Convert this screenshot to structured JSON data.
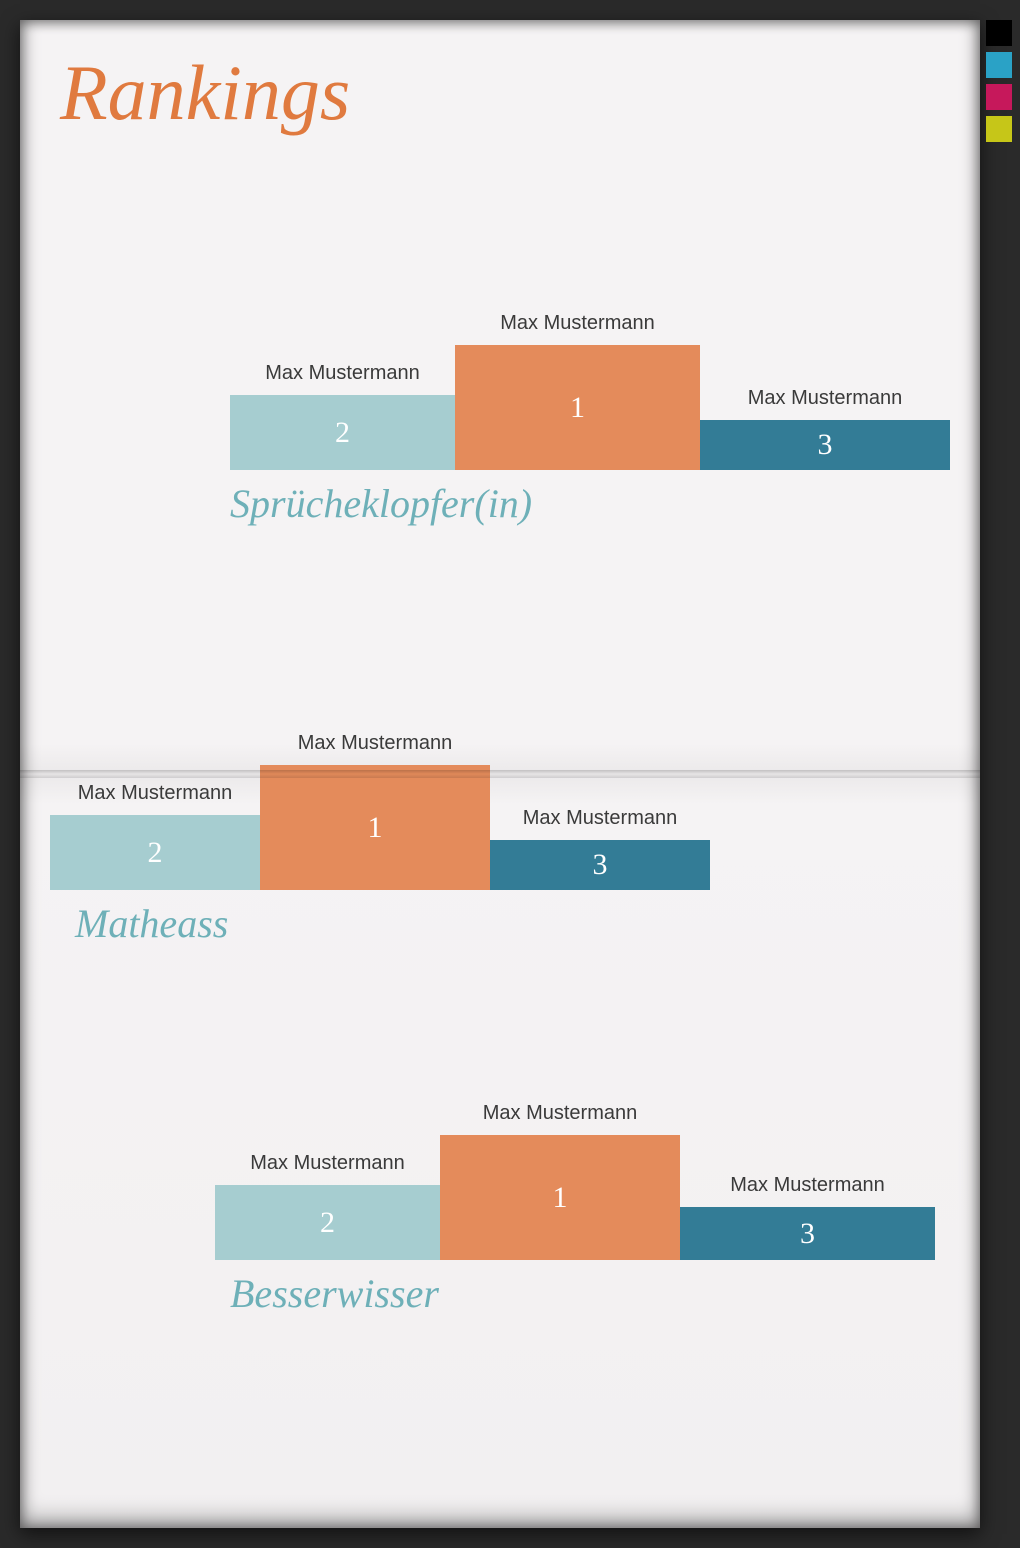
{
  "title": "Rankings",
  "print_bars": [
    "#000000",
    "#2aa2c6",
    "#c6185b",
    "#c6c618"
  ],
  "charts": [
    {
      "subtitle": "Sprücheklopfer(in)",
      "second": {
        "name": "Max Mustermann",
        "rank": "2"
      },
      "first": {
        "name": "Max Mustermann",
        "rank": "1"
      },
      "third": {
        "name": "Max Mustermann",
        "rank": "3"
      }
    },
    {
      "subtitle": "Matheass",
      "second": {
        "name": "Max Mustermann",
        "rank": "2"
      },
      "first": {
        "name": "Max Mustermann",
        "rank": "1"
      },
      "third": {
        "name": "Max Mustermann",
        "rank": "3"
      }
    },
    {
      "subtitle": "Besserwisser",
      "second": {
        "name": "Max Mustermann",
        "rank": "2"
      },
      "first": {
        "name": "Max Mustermann",
        "rank": "1"
      },
      "third": {
        "name": "Max Mustermann",
        "rank": "3"
      }
    }
  ],
  "chart_data": [
    {
      "type": "bar",
      "title": "Sprücheklopfer(in)",
      "categories": [
        "2nd — Max Mustermann",
        "1st — Max Mustermann",
        "3rd — Max Mustermann"
      ],
      "values": [
        2,
        1,
        3
      ],
      "bar_heights_relative": [
        0.6,
        1.0,
        0.4
      ],
      "colors": [
        "#a6cdd0",
        "#e48b5b",
        "#337c96"
      ]
    },
    {
      "type": "bar",
      "title": "Matheass",
      "categories": [
        "2nd — Max Mustermann",
        "1st — Max Mustermann",
        "3rd — Max Mustermann"
      ],
      "values": [
        2,
        1,
        3
      ],
      "bar_heights_relative": [
        0.6,
        1.0,
        0.4
      ],
      "colors": [
        "#a6cdd0",
        "#e48b5b",
        "#337c96"
      ]
    },
    {
      "type": "bar",
      "title": "Besserwisser",
      "categories": [
        "2nd — Max Mustermann",
        "1st — Max Mustermann",
        "3rd — Max Mustermann"
      ],
      "values": [
        2,
        1,
        3
      ],
      "bar_heights_relative": [
        0.6,
        1.0,
        0.42
      ],
      "colors": [
        "#a6cdd0",
        "#e48b5b",
        "#337c96"
      ]
    }
  ]
}
